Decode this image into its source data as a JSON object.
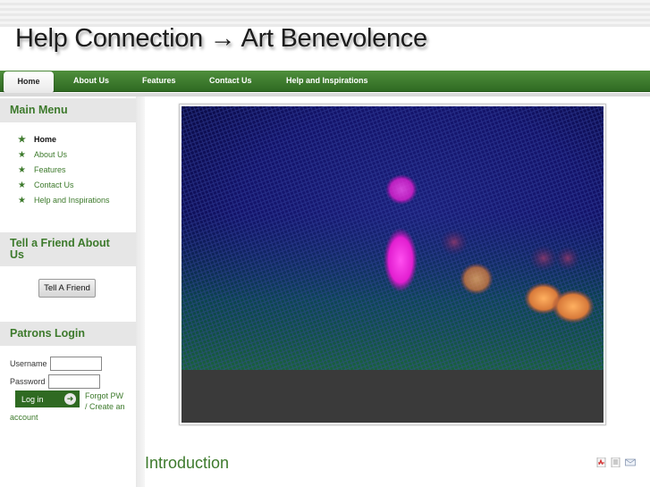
{
  "header": {
    "title": "Help Connection → Art Benevolence"
  },
  "nav": {
    "items": [
      {
        "label": "Home",
        "active": true
      },
      {
        "label": "About Us"
      },
      {
        "label": "Features"
      },
      {
        "label": "Contact Us"
      },
      {
        "label": "Help and Inspirations"
      }
    ]
  },
  "sidebar": {
    "main_menu": {
      "title": "Main Menu",
      "items": [
        "Home",
        "About Us",
        "Features",
        "Contact Us",
        "Help and Inspirations"
      ]
    },
    "tell_friend": {
      "title": "Tell a Friend About Us",
      "button_label": "Tell A Friend"
    },
    "login": {
      "title": "Patrons Login",
      "username_label": "Username",
      "password_label": "Password",
      "button_label": "Log in",
      "forgot_label": "Forgot PW",
      "create_label": "/ Create an",
      "account_label": "account"
    }
  },
  "main": {
    "intro_title": "Introduction"
  },
  "icons": {
    "pdf": "pdf-icon",
    "print": "print-icon",
    "email": "email-icon",
    "menu_bullet": "star-icon",
    "login": "arrow-icon"
  },
  "colors": {
    "accent_green": "#3d7a2c",
    "nav_green": "#2f6a22",
    "banner_dark": "#3a3a3a"
  }
}
